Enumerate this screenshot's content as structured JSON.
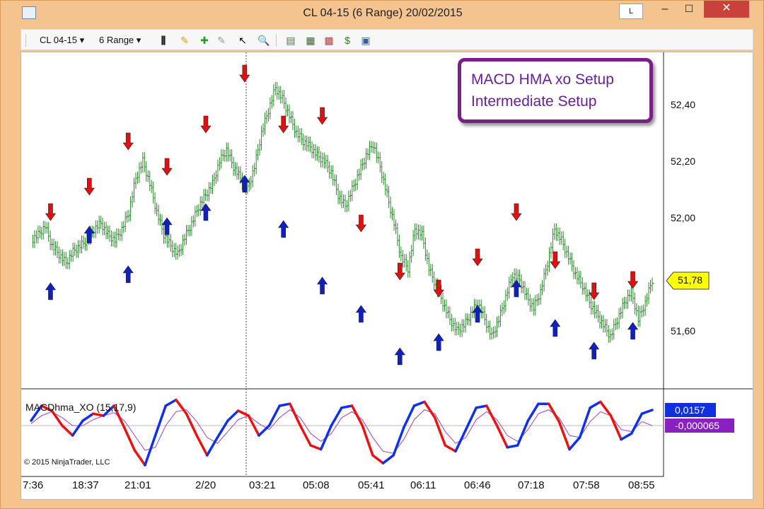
{
  "window": {
    "title": "CL 04-15 (6 Range)  20/02/2015",
    "lock_label": "L",
    "minimize": "–",
    "maximize": "☐",
    "close": "✕"
  },
  "toolbar": {
    "instrument": "CL 04-15",
    "period": "6 Range"
  },
  "annotation": {
    "line1": "MACD HMA xo Setup",
    "line2": "Intermediate Setup"
  },
  "indicator": {
    "label": "MACDhma_XO (15,17,9)",
    "macd_value": "0,0157",
    "signal_value": "-0,000065"
  },
  "copyright": "© 2015 NinjaTrader, LLC",
  "price_axis": {
    "ticks": [
      "52,40",
      "52,20",
      "52,00",
      "51,60"
    ],
    "last_price": "51,78",
    "last_price_color": "#ffff00"
  },
  "time_axis": {
    "ticks": [
      "7:36",
      "18:37",
      "21:01",
      "2/20",
      "03:21",
      "05:08",
      "05:41",
      "06:11",
      "06:46",
      "07:18",
      "07:58",
      "08:55"
    ]
  },
  "colors": {
    "bars": "#2a8a2a",
    "up_arrow": "#1020c0",
    "down_arrow": "#e01010",
    "macd_up": "#1030f0",
    "macd_down": "#f01010",
    "signal": "#a040d0"
  },
  "chart_data": {
    "type": "line",
    "price_close": [
      51.92,
      51.94,
      51.97,
      51.9,
      51.87,
      51.84,
      51.88,
      51.9,
      51.92,
      51.96,
      51.98,
      51.94,
      51.92,
      51.96,
      52.02,
      52.14,
      52.2,
      52.12,
      52.02,
      51.94,
      51.9,
      51.87,
      51.93,
      51.98,
      52.04,
      52.08,
      52.12,
      52.2,
      52.24,
      52.18,
      52.14,
      52.1,
      52.18,
      52.3,
      52.38,
      52.46,
      52.42,
      52.36,
      52.3,
      52.27,
      52.25,
      52.22,
      52.2,
      52.16,
      52.08,
      52.04,
      52.1,
      52.16,
      52.22,
      52.26,
      52.18,
      52.08,
      51.98,
      51.86,
      51.82,
      51.96,
      51.94,
      51.82,
      51.76,
      51.7,
      51.64,
      51.6,
      51.62,
      51.66,
      51.7,
      51.64,
      51.58,
      51.64,
      51.72,
      51.8,
      51.78,
      51.72,
      51.68,
      51.74,
      51.84,
      51.96,
      51.92,
      51.86,
      51.8,
      51.76,
      51.7,
      51.66,
      51.62,
      51.58,
      51.64,
      51.7,
      51.74,
      51.64,
      51.7,
      51.78
    ],
    "down_arrows_price": [
      51.99,
      52.08,
      52.24,
      52.15,
      52.3,
      52.48,
      52.3,
      52.33,
      51.95,
      51.78,
      51.72,
      51.83,
      51.99,
      51.82,
      51.71,
      51.75
    ],
    "up_arrows_price": [
      51.77,
      51.97,
      51.83,
      52.0,
      52.05,
      52.15,
      51.99,
      51.79,
      51.69,
      51.54,
      51.59,
      51.69,
      51.78,
      51.64,
      51.56,
      51.63
    ],
    "macd": [
      0.005,
      0.02,
      0.015,
      0.0,
      -0.01,
      0.005,
      0.012,
      0.01,
      0.02,
      -0.002,
      -0.025,
      -0.04,
      -0.01,
      0.02,
      0.026,
      0.012,
      -0.01,
      -0.03,
      -0.012,
      0.005,
      0.015,
      0.01,
      -0.01,
      0.0,
      0.02,
      0.022,
      0.0,
      -0.02,
      -0.024,
      0.0,
      0.018,
      0.02,
      0.0,
      -0.03,
      -0.038,
      -0.03,
      -0.002,
      0.02,
      0.024,
      0.008,
      -0.02,
      -0.026,
      -0.004,
      0.018,
      0.02,
      0.0,
      -0.022,
      -0.02,
      0.005,
      0.022,
      0.022,
      0.004,
      -0.024,
      -0.012,
      0.018,
      0.024,
      0.01,
      -0.014,
      -0.008,
      0.012,
      0.0157
    ],
    "signal": [
      0.002,
      0.01,
      0.014,
      0.008,
      0.0,
      0.0,
      0.006,
      0.01,
      0.013,
      0.005,
      -0.01,
      -0.025,
      -0.022,
      0.0,
      0.014,
      0.016,
      0.004,
      -0.012,
      -0.018,
      -0.006,
      0.006,
      0.01,
      0.002,
      -0.004,
      0.008,
      0.016,
      0.008,
      -0.008,
      -0.016,
      -0.008,
      0.008,
      0.014,
      0.006,
      -0.012,
      -0.026,
      -0.028,
      -0.014,
      0.006,
      0.016,
      0.012,
      -0.006,
      -0.018,
      -0.012,
      0.006,
      0.014,
      0.006,
      -0.01,
      -0.016,
      -0.004,
      0.012,
      0.016,
      0.008,
      -0.01,
      -0.012,
      0.004,
      0.014,
      0.01,
      -0.004,
      -0.006,
      0.004,
      -6.5e-05
    ]
  }
}
